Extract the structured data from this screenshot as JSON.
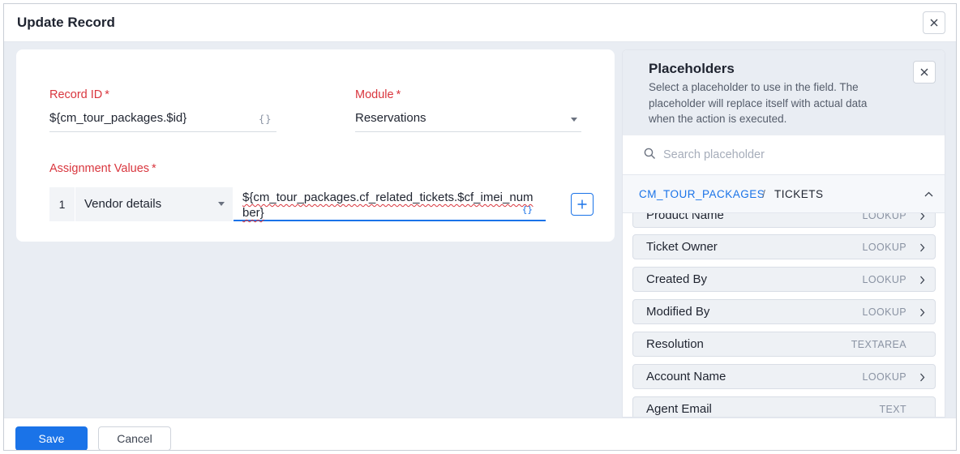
{
  "dialog": {
    "title": "Update Record",
    "close_icon": "close-icon"
  },
  "form": {
    "record_id": {
      "label": "Record ID",
      "required_mark": "*",
      "value": "${cm_tour_packages.$id}",
      "braces": "{}"
    },
    "module": {
      "label": "Module",
      "required_mark": "*",
      "value": "Reservations"
    },
    "assignment": {
      "label": "Assignment Values",
      "required_mark": "*",
      "rows": [
        {
          "index": "1",
          "field": "Vendor details",
          "value": "${cm_tour_packages.cf_related_tickets.$cf_imei_number}",
          "braces": "{}"
        }
      ],
      "add_icon": "plus-icon"
    }
  },
  "placeholders": {
    "title": "Placeholders",
    "description": "Select a placeholder to use in the field. The placeholder will replace itself with actual data when the action is executed.",
    "search_placeholder": "Search placeholder",
    "breadcrumb": {
      "parent": "CM_TOUR_PACKAGES",
      "separator": "/",
      "current": "TICKETS"
    },
    "items": [
      {
        "name": "Product Name",
        "type": "LOOKUP",
        "chevron": true
      },
      {
        "name": "Ticket Owner",
        "type": "LOOKUP",
        "chevron": true
      },
      {
        "name": "Created By",
        "type": "LOOKUP",
        "chevron": true
      },
      {
        "name": "Modified By",
        "type": "LOOKUP",
        "chevron": true
      },
      {
        "name": "Resolution",
        "type": "TEXTAREA",
        "chevron": false
      },
      {
        "name": "Account Name",
        "type": "LOOKUP",
        "chevron": true
      },
      {
        "name": "Agent Email",
        "type": "TEXT",
        "chevron": false
      }
    ]
  },
  "footer": {
    "save_label": "Save",
    "cancel_label": "Cancel"
  },
  "colors": {
    "accent": "#1a73e8",
    "required": "#d9363e",
    "panel_bg": "#e9edf3"
  }
}
